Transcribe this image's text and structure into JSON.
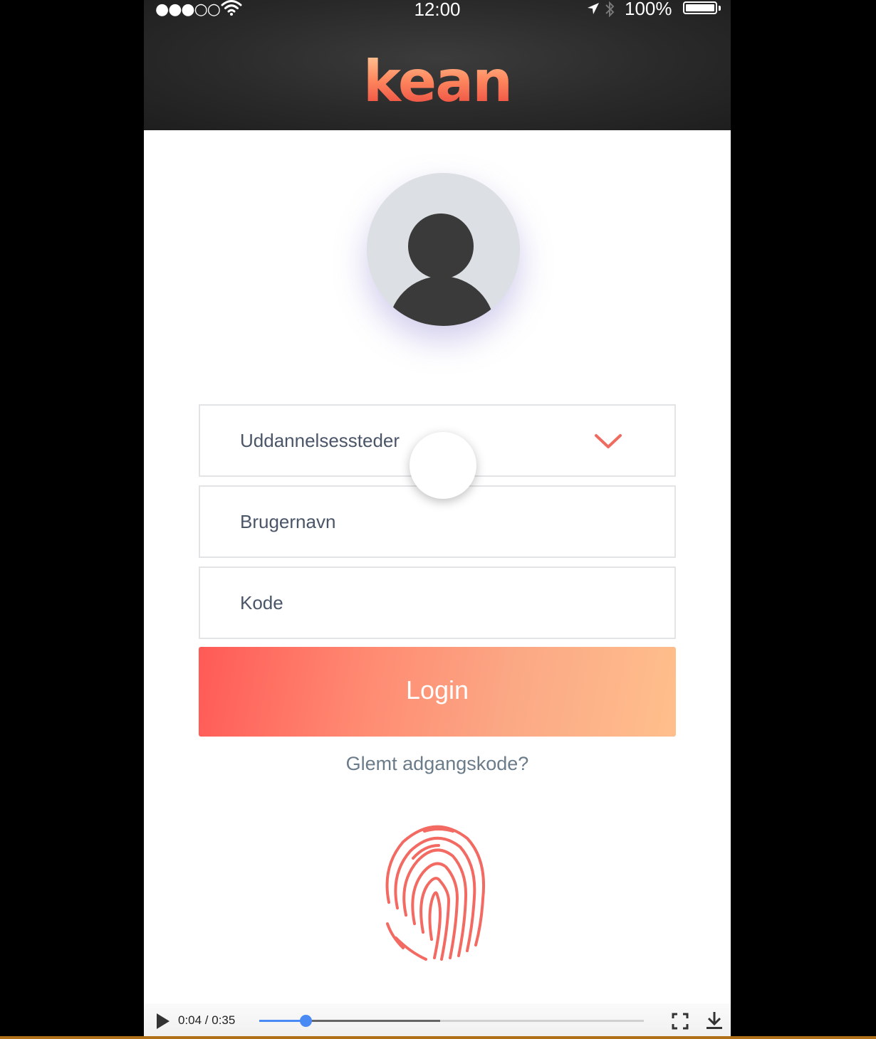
{
  "status_bar": {
    "signal": "●●●○○",
    "time": "12:00",
    "battery": "100%"
  },
  "header": {
    "logo": "kean"
  },
  "form": {
    "institution_select": "Uddannelsessteder",
    "username_placeholder": "Brugernavn",
    "password_placeholder": "Kode",
    "login_label": "Login",
    "forgot_label": "Glemt adgangskode?"
  },
  "video_controls": {
    "time": "0:04 / 0:35",
    "progress": 0.12,
    "buffered": 0.47
  },
  "colors": {
    "accent": "#ff5a56",
    "accent_light": "#ffbf8c",
    "text_muted": "#6a7b8a"
  },
  "icons": [
    "wifi-icon",
    "location-icon",
    "bluetooth-icon",
    "battery-icon",
    "avatar-icon",
    "chevron-down-icon",
    "fingerprint-icon",
    "play-icon",
    "fullscreen-icon",
    "download-icon"
  ]
}
